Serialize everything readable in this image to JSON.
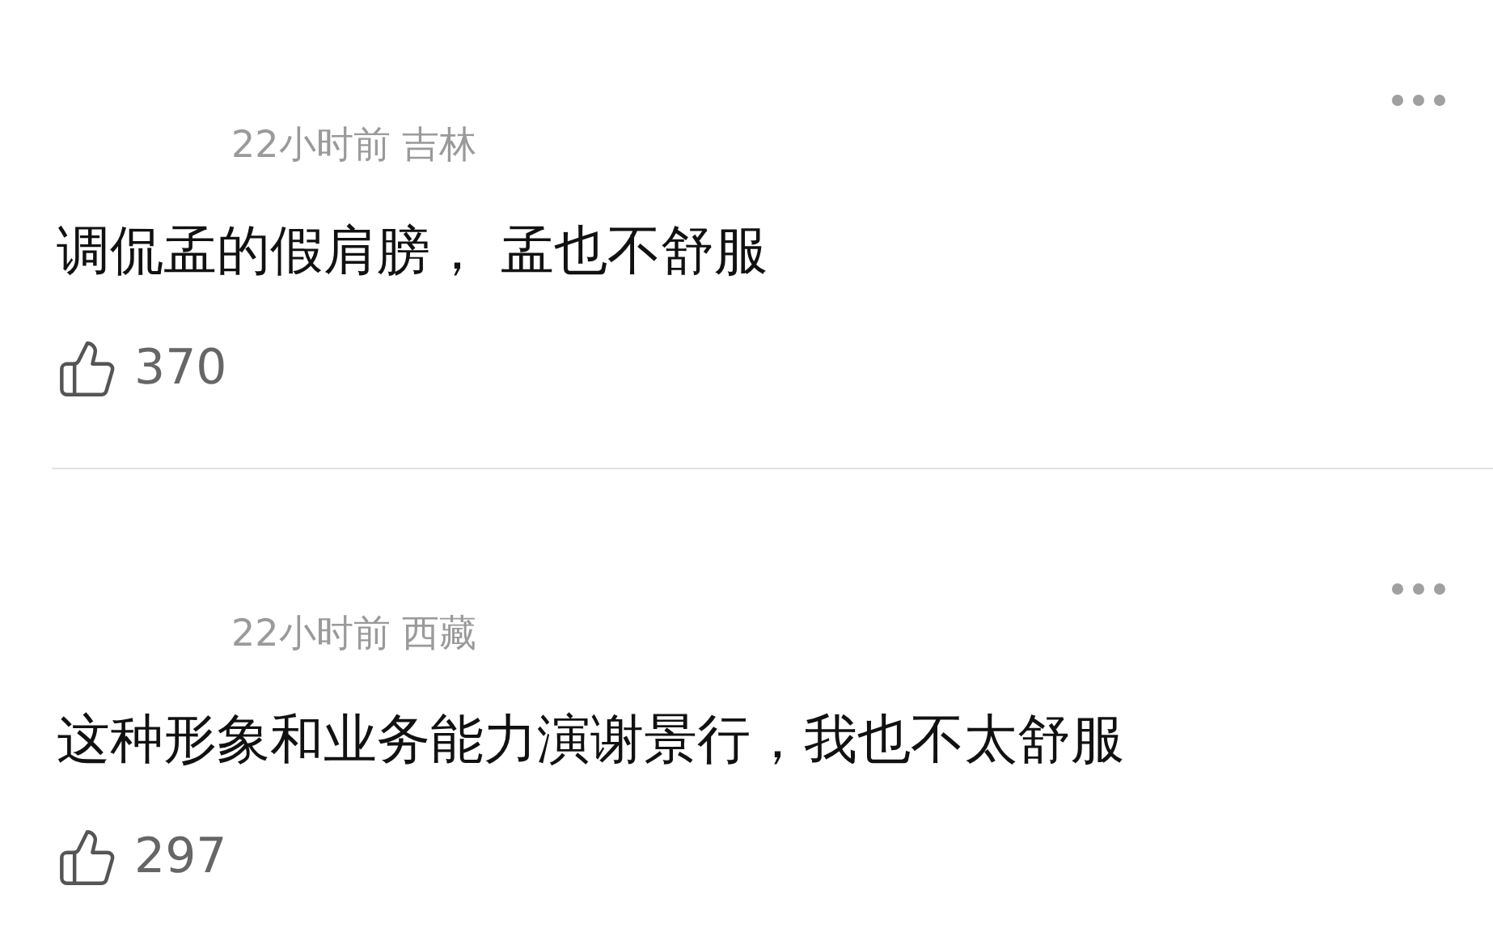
{
  "comments": [
    {
      "time": "22小时前",
      "location": "吉林",
      "content": "调侃孟的假肩膀， 孟也不舒服",
      "likes": "370"
    },
    {
      "time": "22小时前",
      "location": "西藏",
      "content": "这种形象和业务能力演谢景行，我也不太舒服",
      "likes": "297"
    }
  ]
}
